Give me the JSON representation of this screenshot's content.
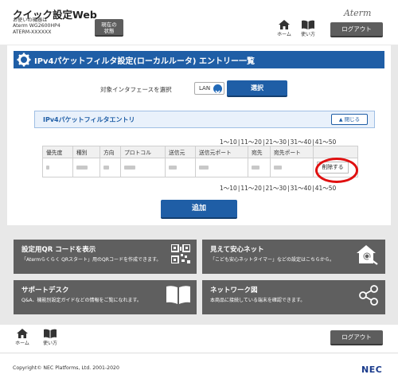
{
  "header": {
    "app_title": "クイック設定Web",
    "model_lines": [
      "お使いの機器は",
      "Aterm WG2600HP4",
      "ATERM-XXXXXX"
    ],
    "status_button": "現在の\n状態",
    "brand": "Aterm",
    "home_label": "ホーム",
    "help_label": "使い方",
    "logout_label": "ログアウト"
  },
  "page": {
    "title": "IPv4パケットフィルタ設定(ローカルルータ) エントリー一覧",
    "interface_label": "対象インタフェースを選択",
    "interface_value": "LAN",
    "select_button": "選択",
    "section_title": "IPv4パケットフィルタエントリ",
    "close_label": "閉じる",
    "pager": [
      "1～10",
      "11～20",
      "21～30",
      "31～40",
      "41～50"
    ],
    "table": {
      "headers": [
        "優先度",
        "種別",
        "方向",
        "プロトコル",
        "送信元",
        "送信元ポート",
        "宛先",
        "宛先ポート",
        ""
      ],
      "delete_label": "削除する"
    },
    "add_button": "追加"
  },
  "cards": [
    {
      "title": "設定用QR コードを表示",
      "desc": "「Atermらくらく QRスタート」用のQRコードを作成できます。",
      "icon": "qr-code-icon"
    },
    {
      "title": "見えて安心ネット",
      "desc": "「こども安心ネットタイマー」などの設定はこちらから。",
      "icon": "house-search-icon"
    },
    {
      "title": "サポートデスク",
      "desc": "Q&A、機能別設定ガイドなどの情報をご覧になれます。",
      "icon": "book-icon"
    },
    {
      "title": "ネットワーク図",
      "desc": "本商品に接続している端末を確認できます。",
      "icon": "network-icon"
    }
  ],
  "footer": {
    "home_label": "ホーム",
    "help_label": "使い方",
    "logout_label": "ログアウト",
    "copyright": "Copyright© NEC Platforms, Ltd. 2001-2020",
    "logo": "NEC"
  },
  "colors": {
    "primary": "#1f5ea6",
    "card_bg": "#5f5f5f",
    "highlight": "#e01010"
  }
}
